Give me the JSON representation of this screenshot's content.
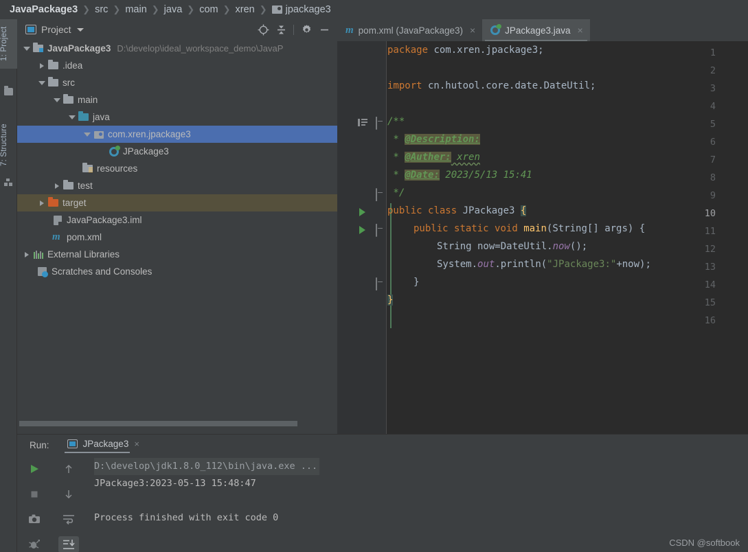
{
  "breadcrumb": {
    "items": [
      {
        "label": "JavaPackage3",
        "bold": true
      },
      {
        "label": "src"
      },
      {
        "label": "main"
      },
      {
        "label": "java"
      },
      {
        "label": "com"
      },
      {
        "label": "xren"
      },
      {
        "label": "jpackage3",
        "icon": "package-icon"
      }
    ]
  },
  "leftbar": {
    "project_tab": "1: Project",
    "structure_tab": "7: Structure"
  },
  "project_panel": {
    "title": "Project",
    "buttons": {
      "locate": "locate-icon",
      "collapse": "collapse-all-icon",
      "settings": "gear-icon",
      "hide": "minimize-icon"
    },
    "tree": [
      {
        "label": "JavaPackage3",
        "sub": "D:\\develop\\ideal_workspace_demo\\JavaP",
        "depth": 0,
        "arrow": "open",
        "icon": "module-folder",
        "bold": true
      },
      {
        "label": ".idea",
        "depth": 1,
        "arrow": "closed",
        "icon": "folder-gray"
      },
      {
        "label": "src",
        "depth": 1,
        "arrow": "open",
        "icon": "folder-gray"
      },
      {
        "label": "main",
        "depth": 2,
        "arrow": "open",
        "icon": "folder-gray"
      },
      {
        "label": "java",
        "depth": 3,
        "arrow": "open",
        "icon": "folder-source"
      },
      {
        "label": "com.xren.jpackage3",
        "depth": 4,
        "arrow": "open",
        "icon": "package-icon",
        "selected": true
      },
      {
        "label": "JPackage3",
        "depth": 5,
        "arrow": "none",
        "icon": "java-class"
      },
      {
        "label": "resources",
        "depth": 3,
        "arrow": "none",
        "icon": "folder-resources"
      },
      {
        "label": "test",
        "depth": 2,
        "arrow": "closed",
        "icon": "folder-gray"
      },
      {
        "label": "target",
        "depth": 1,
        "arrow": "closed",
        "icon": "folder-orange",
        "highlight": true
      },
      {
        "label": "JavaPackage3.iml",
        "depth": 1,
        "arrow": "none",
        "icon": "iml-file"
      },
      {
        "label": "pom.xml",
        "depth": 1,
        "arrow": "none",
        "icon": "maven-file"
      },
      {
        "label": "External Libraries",
        "depth": 0,
        "arrow": "closed",
        "icon": "libraries-icon"
      },
      {
        "label": "Scratches and Consoles",
        "depth": 0,
        "arrow": "none",
        "icon": "scratches-icon"
      }
    ]
  },
  "editor": {
    "tabs": [
      {
        "label": "pom.xml (JavaPackage3)",
        "icon": "maven-file",
        "active": false,
        "close": "×"
      },
      {
        "label": "JPackage3.java",
        "icon": "java-class",
        "active": true,
        "close": "×"
      }
    ],
    "line_numbers": [
      "1",
      "2",
      "3",
      "4",
      "5",
      "6",
      "7",
      "8",
      "9",
      "10",
      "11",
      "12",
      "13",
      "14",
      "15",
      "16"
    ],
    "current_line": 10,
    "code": [
      "package com.xren.jpackage3;",
      "",
      "import cn.hutool.core.date.DateUtil;",
      "",
      "/**",
      " * @Description:",
      " * @Auther: xren",
      " * @Date: 2023/5/13 15:41",
      " */",
      "public class JPackage3 {",
      "    public static void main(String[] args) {",
      "        String now=DateUtil.now();",
      "        System.out.println(\"JPackage3:\"+now);",
      "    }",
      "}",
      ""
    ],
    "tokens": {
      "kw_package": "package",
      "pkg_name": " com.xren.jpackage3;",
      "kw_import": "import",
      "import_name": " cn.hutool.core.date.DateUtil;",
      "doc_open": "/**",
      "doc_star": " * ",
      "tag_description": "@Description:",
      "tag_auther": "@Auther:",
      "auther_value": " xren",
      "tag_date": "@Date:",
      "date_value": " 2023/5/13 15:41",
      "doc_close": " */",
      "kw_public": "public",
      "kw_class": "class",
      "class_name": "JPackage3",
      "brace_open": "{",
      "kw_static": "static",
      "kw_void": "void",
      "method_main": "main",
      "main_params": "(String[] args) {",
      "type_string": "String",
      "var_now": " now=DateUtil.",
      "call_now": "now",
      "call_now_end": "();",
      "system": "System.",
      "field_out": "out",
      "println": ".println(",
      "string_literal": "\"JPackage3:\"",
      "concat_now": "+now);",
      "close_inner": "}",
      "close_outer": "}"
    }
  },
  "run_panel": {
    "label": "Run:",
    "tab": "JPackage3",
    "tab_close": "×",
    "toolbar": {
      "rerun": "play-icon",
      "stop": "stop-icon",
      "screenshot": "camera-icon",
      "debug": "bug-icon",
      "up": "arrow-up-icon",
      "down": "arrow-down-icon",
      "soft_wrap": "soft-wrap-icon",
      "scroll_end": "scroll-to-end-icon"
    },
    "console": [
      {
        "text": "D:\\develop\\jdk1.8.0_112\\bin\\java.exe ...",
        "style": "cmdline"
      },
      {
        "text": "JPackage3:2023-05-13 15:48:47",
        "style": "normal"
      },
      {
        "text": "",
        "style": "blank"
      },
      {
        "text": "Process finished with exit code 0",
        "style": "normal"
      }
    ]
  },
  "watermark": "CSDN @softbook",
  "colors": {
    "background": "#3c3f41",
    "editor_bg": "#2b2b2b",
    "selection": "#4b6eaf",
    "target_highlight": "#55503c",
    "keyword": "#cc7832",
    "comment": "#629755",
    "string": "#6a8759",
    "method": "#ffc66d",
    "field": "#9876aa",
    "accent": "#3592c4"
  }
}
